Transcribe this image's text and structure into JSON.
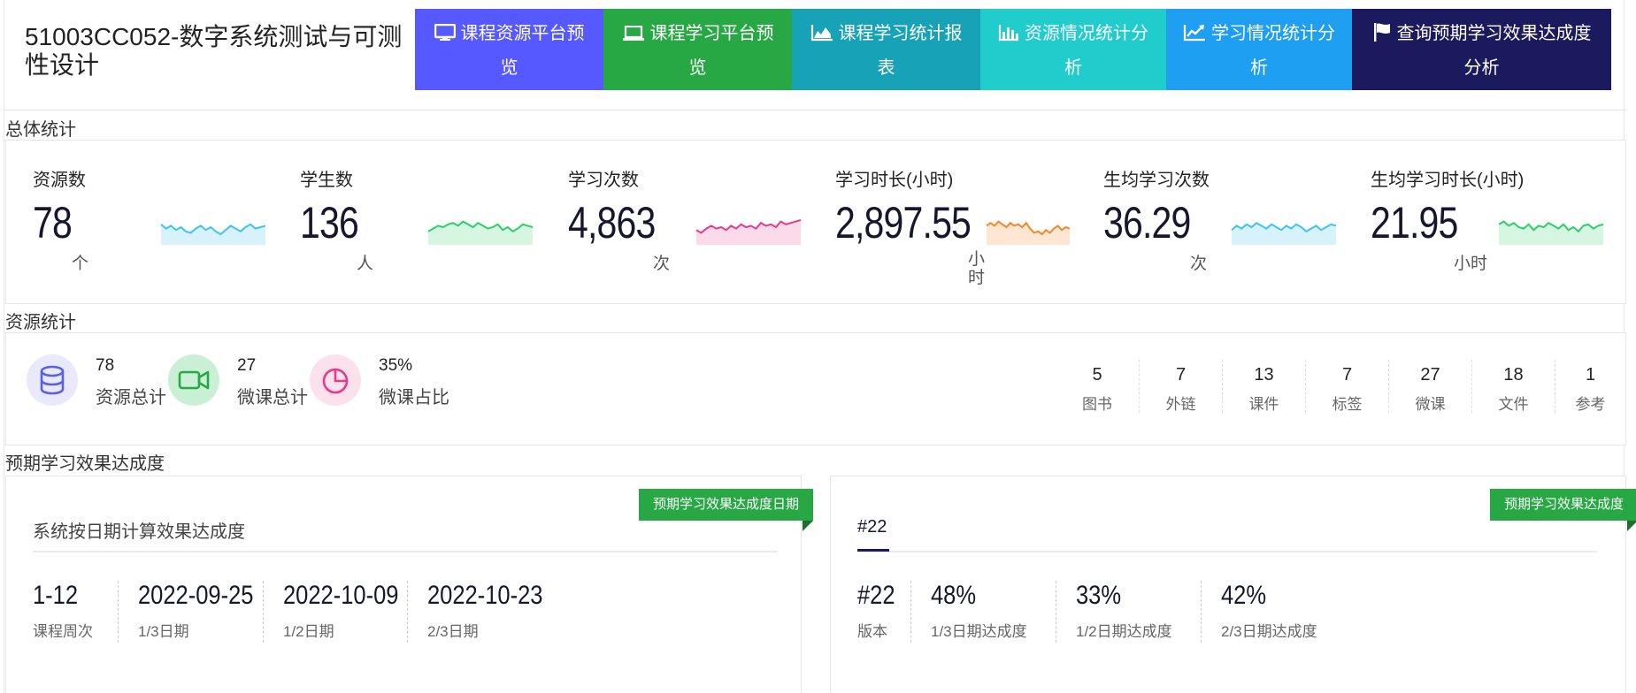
{
  "header": {
    "course_title": "51003CC052-数字系统测试与可测性设计",
    "nav": [
      {
        "label": "课程资源平台预览",
        "icon": "monitor-icon"
      },
      {
        "label": "课程学习平台预览",
        "icon": "laptop-icon"
      },
      {
        "label": "课程学习统计报表",
        "icon": "area-chart-icon"
      },
      {
        "label": "资源情况统计分析",
        "icon": "bar-chart-icon"
      },
      {
        "label": "学习情况统计分析",
        "icon": "line-chart-icon"
      },
      {
        "label": "查询预期学习效果达成度分析",
        "icon": "flag-icon"
      }
    ]
  },
  "overall": {
    "section_label": "总体统计",
    "stats": [
      {
        "label": "资源数",
        "value": "78",
        "unit": "个",
        "color": "#3fc3f0",
        "fill": "#d8f2fc",
        "trend": [
          0.6,
          0.45,
          0.55,
          0.4,
          0.5,
          0.35,
          0.3,
          0.45,
          0.55,
          0.4,
          0.5,
          0.35,
          0.25,
          0.4,
          0.55,
          0.45,
          0.35,
          0.5,
          0.6,
          0.45,
          0.5,
          0.55
        ]
      },
      {
        "label": "学生数",
        "value": "136",
        "unit": "人",
        "color": "#2bd06a",
        "fill": "#d6f6e2",
        "trend": [
          0.35,
          0.45,
          0.55,
          0.5,
          0.6,
          0.65,
          0.55,
          0.7,
          0.6,
          0.5,
          0.65,
          0.55,
          0.45,
          0.5,
          0.6,
          0.4,
          0.5,
          0.35,
          0.45,
          0.6,
          0.55,
          0.5
        ]
      },
      {
        "label": "学习次数",
        "value": "4,863",
        "unit": "次",
        "color": "#e8398a",
        "fill": "#fbdbe9",
        "trend": [
          0.4,
          0.3,
          0.45,
          0.55,
          0.45,
          0.5,
          0.4,
          0.55,
          0.45,
          0.6,
          0.5,
          0.55,
          0.45,
          0.65,
          0.55,
          0.6,
          0.5,
          0.7,
          0.6,
          0.65,
          0.7,
          0.75
        ]
      },
      {
        "label": "学习时长(小时)",
        "value": "2,897.55",
        "unit": "小时",
        "color": "#f3882a",
        "fill": "#fde6d2",
        "trend": [
          0.55,
          0.65,
          0.55,
          0.7,
          0.6,
          0.5,
          0.65,
          0.55,
          0.6,
          0.5,
          0.65,
          0.45,
          0.3,
          0.35,
          0.25,
          0.4,
          0.3,
          0.45,
          0.55,
          0.4,
          0.5,
          0.45
        ]
      },
      {
        "label": "生均学习次数",
        "value": "36.29",
        "unit": "次",
        "color": "#3fc3f0",
        "fill": "#d8f2fc",
        "trend": [
          0.4,
          0.55,
          0.45,
          0.6,
          0.5,
          0.65,
          0.55,
          0.45,
          0.6,
          0.5,
          0.4,
          0.55,
          0.45,
          0.6,
          0.5,
          0.35,
          0.45,
          0.55,
          0.4,
          0.5,
          0.6,
          0.55
        ]
      },
      {
        "label": "生均学习时长(小时)",
        "value": "21.95",
        "unit": "小时",
        "color": "#2bd06a",
        "fill": "#d6f6e2",
        "trend": [
          0.6,
          0.7,
          0.55,
          0.65,
          0.5,
          0.45,
          0.6,
          0.4,
          0.55,
          0.5,
          0.65,
          0.55,
          0.45,
          0.6,
          0.4,
          0.5,
          0.35,
          0.55,
          0.6,
          0.45,
          0.55,
          0.6
        ]
      }
    ]
  },
  "resources": {
    "section_label": "资源统计",
    "summary": [
      {
        "value": "78",
        "label": "资源总计",
        "icon": "database-icon",
        "color": "#5b5fe6",
        "bg": "#e8e9fb"
      },
      {
        "value": "27",
        "label": "微课总计",
        "icon": "video-camera-icon",
        "color": "#28a844",
        "bg": "#c9efd4"
      },
      {
        "value": "35%",
        "label": "微课占比",
        "icon": "pie-chart-icon",
        "color": "#e8398a",
        "bg": "#fbe1ec"
      }
    ],
    "types": [
      {
        "value": "5",
        "label": "图书"
      },
      {
        "value": "7",
        "label": "外链"
      },
      {
        "value": "13",
        "label": "课件"
      },
      {
        "value": "7",
        "label": "标签"
      },
      {
        "value": "27",
        "label": "微课"
      },
      {
        "value": "18",
        "label": "文件"
      },
      {
        "value": "1",
        "label": "参考"
      }
    ]
  },
  "achievement": {
    "section_label": "预期学习效果达成度",
    "date_card": {
      "ribbon": "预期学习效果达成度日期",
      "title": "系统按日期计算效果达成度",
      "metrics": [
        {
          "value": "1-12",
          "label": "课程周次"
        },
        {
          "value": "2022-09-25",
          "label": "1/3日期"
        },
        {
          "value": "2022-10-09",
          "label": "1/2日期"
        },
        {
          "value": "2022-10-23",
          "label": "2/3日期"
        }
      ]
    },
    "rate_card": {
      "ribbon": "预期学习效果达成度",
      "title": "#22",
      "metrics": [
        {
          "value": "#22",
          "label": "版本"
        },
        {
          "value": "48%",
          "label": "1/3日期达成度"
        },
        {
          "value": "33%",
          "label": "1/2日期达成度"
        },
        {
          "value": "42%",
          "label": "2/3日期达成度"
        }
      ]
    }
  }
}
